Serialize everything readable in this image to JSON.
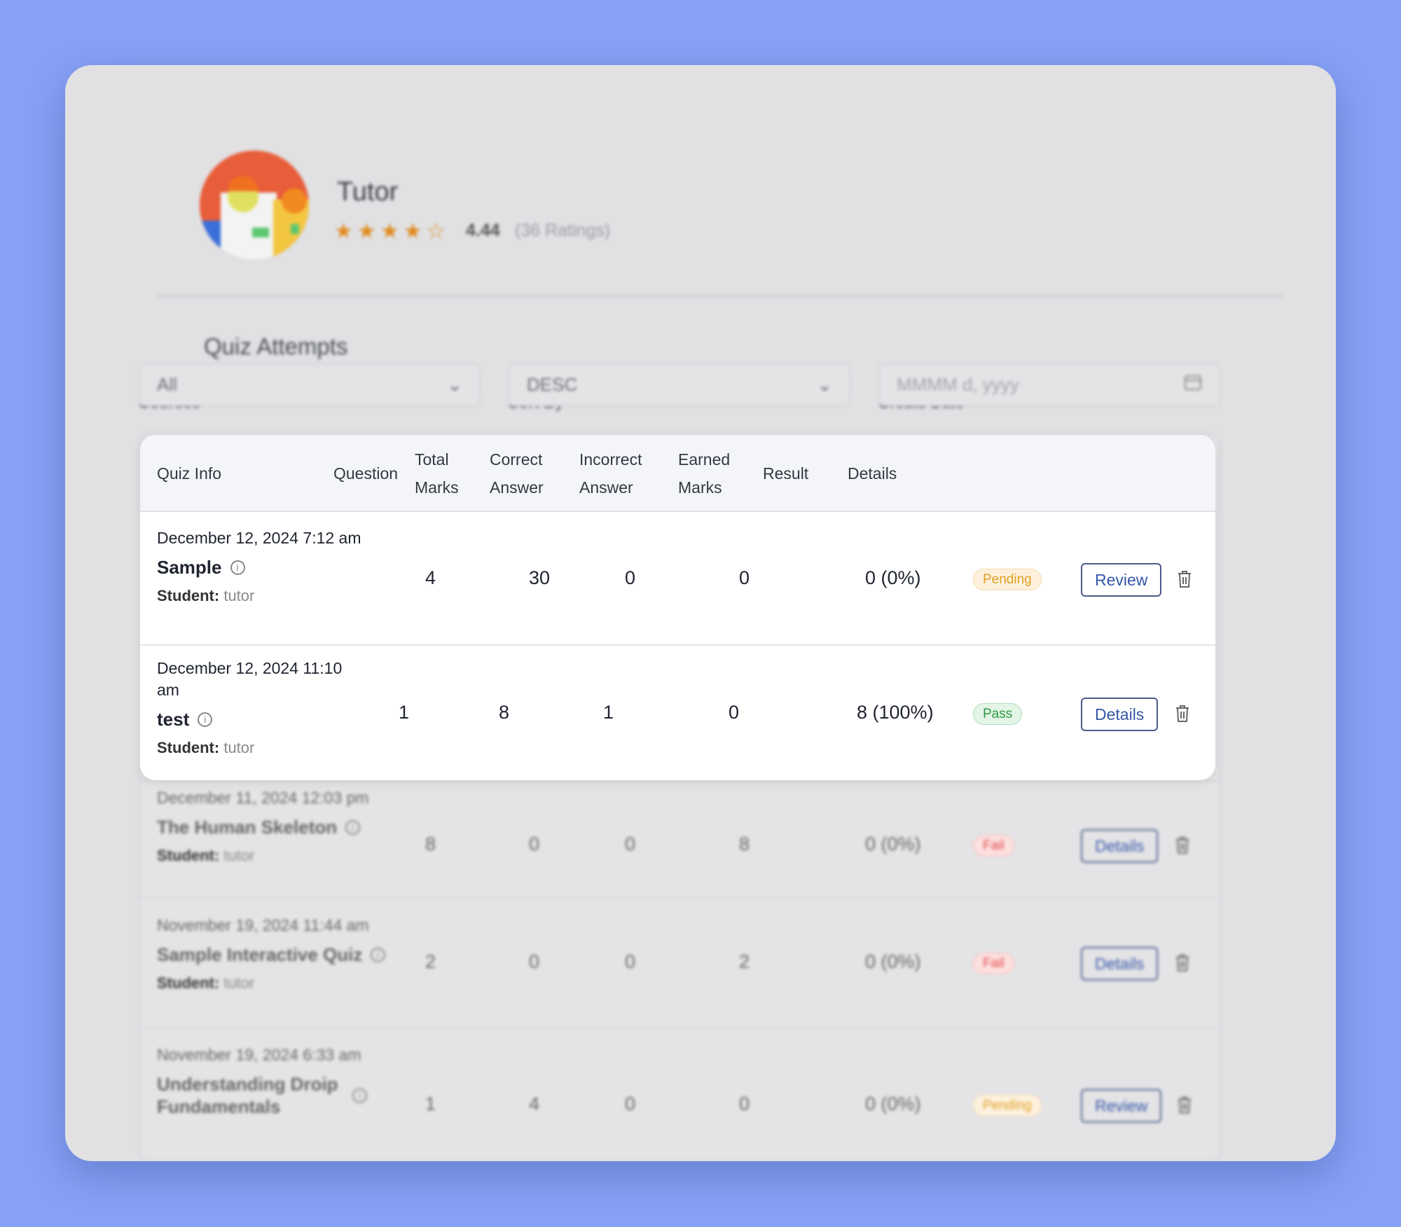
{
  "profile": {
    "name": "Tutor",
    "rating": "4.44",
    "rating_count": "(36 Ratings)",
    "stars_filled": 4,
    "stars_total": 5,
    "star_color": "#e08a1e"
  },
  "section_title": "Quiz Attempts",
  "filters": {
    "courses": {
      "label": "Courses",
      "value": "All"
    },
    "sort": {
      "label": "Sort By",
      "value": "DESC"
    },
    "date": {
      "label": "Create Date",
      "placeholder": "MMMM d, yyyy"
    }
  },
  "table": {
    "headers": [
      [
        "Quiz Info"
      ],
      [
        "Question"
      ],
      [
        "Total",
        "Marks"
      ],
      [
        "Correct",
        "Answer"
      ],
      [
        "Incorrect",
        "Answer"
      ],
      [
        "Earned",
        "Marks"
      ],
      [
        "Result"
      ],
      [
        "Details"
      ]
    ],
    "student_label": "Student:",
    "rows": [
      {
        "date": "December 12, 2024 7:12 am",
        "name": "Sample",
        "student": "tutor",
        "question": "4",
        "total": "30",
        "correct": "0",
        "incorrect": "0",
        "earned": "0 (0%)",
        "result": "Pending",
        "action": "Review"
      },
      {
        "date": "December 12, 2024 11:10 am",
        "name": "test",
        "student": "tutor",
        "question": "1",
        "total": "8",
        "correct": "1",
        "incorrect": "0",
        "earned": "8 (100%)",
        "result": "Pass",
        "action": "Details"
      },
      {
        "date": "December 11, 2024 12:03 pm",
        "name": "The Human Skeleton",
        "student": "tutor",
        "question": "8",
        "total": "0",
        "correct": "0",
        "incorrect": "8",
        "earned": "0 (0%)",
        "result": "Fail",
        "action": "Details"
      },
      {
        "date": "November 19, 2024 11:44 am",
        "name": "Sample Interactive Quiz",
        "student": "tutor",
        "question": "2",
        "total": "0",
        "correct": "0",
        "incorrect": "2",
        "earned": "0 (0%)",
        "result": "Fail",
        "action": "Details"
      },
      {
        "date": "November 19, 2024 6:33 am",
        "name": "Understanding Droip Fundamentals",
        "student": "",
        "question": "1",
        "total": "4",
        "correct": "0",
        "incorrect": "0",
        "earned": "0 (0%)",
        "result": "Pending",
        "action": "Review"
      }
    ]
  },
  "colors": {
    "pending_bg": "#fdf1de",
    "pending_fg": "#e0a020",
    "pass_bg": "#e3f5e6",
    "pass_fg": "#2f9a45",
    "fail_bg": "#fde0e0",
    "fail_fg": "#e04848",
    "accent": "#3556a8"
  }
}
